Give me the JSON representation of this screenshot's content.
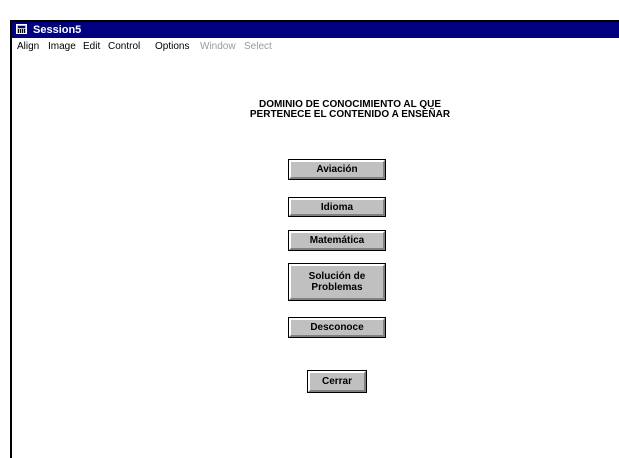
{
  "window": {
    "title": "Session5"
  },
  "menu": {
    "items": [
      {
        "label": "Align",
        "enabled": true
      },
      {
        "label": "Image",
        "enabled": true
      },
      {
        "label": "Edit",
        "enabled": true
      },
      {
        "label": "Control",
        "enabled": true
      },
      {
        "label": "Options",
        "enabled": true
      },
      {
        "label": "Window",
        "enabled": false
      },
      {
        "label": "Select",
        "enabled": false
      }
    ]
  },
  "heading": {
    "line1": "DOMINIO DE CONOCIMIENTO AL QUE",
    "line2": "PERTENECE EL CONTENIDO A ENSEÑAR"
  },
  "buttons": {
    "aviacion": "Aviación",
    "idioma": "Idioma",
    "matematica": "Matemática",
    "solucion_line1": "Solución de",
    "solucion_line2": "Problemas",
    "desconoce": "Desconoce",
    "cerrar": "Cerrar"
  },
  "colors": {
    "titlebar": "#000080",
    "button_face": "#c0c0c0",
    "disabled_text": "#9a9a9a"
  }
}
